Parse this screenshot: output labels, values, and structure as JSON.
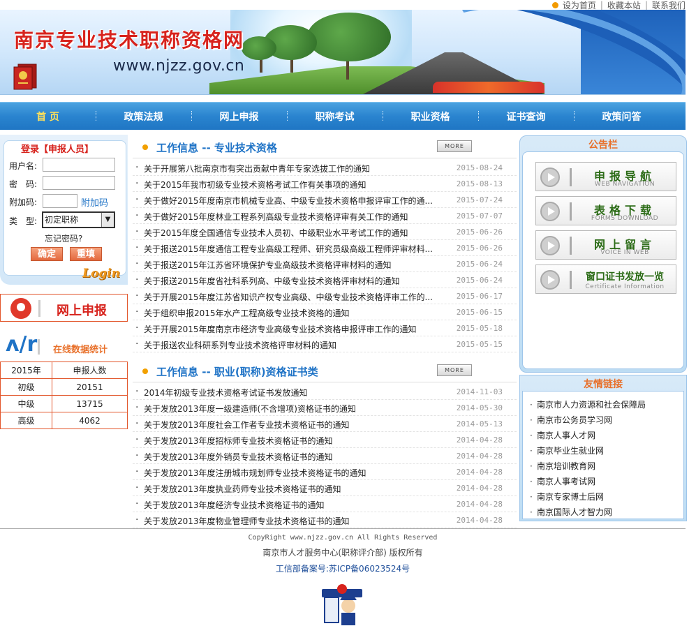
{
  "toplinks": {
    "home": "设为首页",
    "bookmark": "收藏本站",
    "contact": "联系我们"
  },
  "banner": {
    "title": "南京专业技术职称资格网",
    "url": "www.njzz.gov.cn"
  },
  "nav": [
    "首 页",
    "政策法规",
    "网上申报",
    "职称考试",
    "职业资格",
    "证书查询",
    "政策问答"
  ],
  "login": {
    "title": "登录【申报人员】",
    "username_label": "用户名:",
    "password_label": "密　码:",
    "captcha_label": "附加码:",
    "captcha_link": "附加码",
    "type_label": "类　型:",
    "type_value": "初定职称",
    "forgot": "忘记密码?",
    "confirm": "确定",
    "reset": "重填",
    "login_word": "Login"
  },
  "apply": {
    "label": "网上申报"
  },
  "stats": {
    "title": "在线数据统计",
    "header": [
      "2015年",
      "申报人数"
    ],
    "rows": [
      {
        "level": "初级",
        "count": "20151"
      },
      {
        "level": "中级",
        "count": "13715"
      },
      {
        "level": "高级",
        "count": "4062"
      }
    ]
  },
  "section1": {
    "title": "工作信息 -- 专业技术资格",
    "more": "MORE",
    "items": [
      {
        "title": "关于开展第八批南京市有突出贡献中青年专家选拔工作的通知",
        "date": "2015-08-24"
      },
      {
        "title": "关于2015年我市初级专业技术资格考试工作有关事项的通知",
        "date": "2015-08-13"
      },
      {
        "title": "关于做好2015年度南京市机械专业高、中级专业技术资格申报评审工作的通...",
        "date": "2015-07-24"
      },
      {
        "title": "关于做好2015年度林业工程系列高级专业技术资格评审有关工作的通知",
        "date": "2015-07-07"
      },
      {
        "title": "关于2015年度全国通信专业技术人员初、中级职业水平考试工作的通知",
        "date": "2015-06-26"
      },
      {
        "title": "关于报送2015年度通信工程专业高级工程师、研究员级高级工程师评审材料...",
        "date": "2015-06-26"
      },
      {
        "title": "关于报送2015年江苏省环境保护专业高级技术资格评审材料的通知",
        "date": "2015-06-24"
      },
      {
        "title": "关于报送2015年度省社科系列高、中级专业技术资格评审材料的通知",
        "date": "2015-06-24"
      },
      {
        "title": "关于开展2015年度江苏省知识产权专业高级、中级专业技术资格评审工作的...",
        "date": "2015-06-17"
      },
      {
        "title": "关于组织申报2015年水产工程高级专业技术资格的通知",
        "date": "2015-06-15"
      },
      {
        "title": "关于开展2015年度南京市经济专业高级专业技术资格申报评审工作的通知",
        "date": "2015-05-18"
      },
      {
        "title": "关于报送农业科研系列专业技术资格评审材料的通知",
        "date": "2015-05-15"
      }
    ]
  },
  "section2": {
    "title": "工作信息 -- 职业(职称)资格证书类",
    "more": "MORE",
    "items": [
      {
        "title": "2014年初级专业技术资格考试证书发放通知",
        "date": "2014-11-03"
      },
      {
        "title": "关于发放2013年度一级建造师(不含增项)资格证书的通知",
        "date": "2014-05-30"
      },
      {
        "title": "关于发放2013年度社会工作者专业技术资格证书的通知",
        "date": "2014-05-13"
      },
      {
        "title": "关于发放2013年度招标师专业技术资格证书的通知",
        "date": "2014-04-28"
      },
      {
        "title": "关于发放2013年度外销员专业技术资格证书的通知",
        "date": "2014-04-28"
      },
      {
        "title": "关于发放2013年度注册城市规划师专业技术资格证书的通知",
        "date": "2014-04-28"
      },
      {
        "title": "关于发放2013年度执业药师专业技术资格证书的通知",
        "date": "2014-04-28"
      },
      {
        "title": "关于发放2013年度经济专业技术资格证书的通知",
        "date": "2014-04-28"
      },
      {
        "title": "关于发放2013年度物业管理师专业技术资格证书的通知",
        "date": "2014-04-28"
      }
    ]
  },
  "notice": {
    "title": "公告栏",
    "services": [
      {
        "zh": "申报导航",
        "en": "WEB NAVIGATION"
      },
      {
        "zh": "表格下载",
        "en": "FORMS DOWNLOAD"
      },
      {
        "zh": "网上留言",
        "en": "VOICE IN WEB"
      },
      {
        "zh": "窗口证书发放一览",
        "en": "Certificate Information"
      }
    ]
  },
  "links": {
    "title": "友情链接",
    "items": [
      "南京市人力资源和社会保障局",
      "南京市公务员学习网",
      "南京人事人才网",
      "南京毕业生就业网",
      "南京培训教育网",
      "南京人事考试网",
      "南京专家博士后网",
      "南京国际人才智力网"
    ]
  },
  "footer": {
    "copyright": "CopyRight www.njzz.gov.cn All Rights Reserved",
    "owner": "南京市人才服务中心(职称评介部)  版权所有",
    "icp": "工信部备案号:苏ICP备06023524号"
  },
  "colors": {
    "nav_blue": "#2a84cf",
    "title_red": "#d7231d",
    "link_blue": "#1f73c6",
    "accent_orange": "#e8702a"
  }
}
